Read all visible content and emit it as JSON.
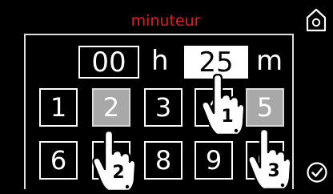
{
  "header": {
    "title": "minuteur"
  },
  "timer": {
    "hours": "00",
    "hours_unit": "h",
    "minutes": "25",
    "minutes_unit": "m"
  },
  "keypad": {
    "keys": [
      "1",
      "2",
      "3",
      "4",
      "5",
      "6",
      "7",
      "8",
      "9",
      "0"
    ],
    "pressed": [
      "2",
      "5"
    ]
  },
  "steps": {
    "step1": "1",
    "step2": "2",
    "step3": "3"
  },
  "icons": {
    "home": "home-icon",
    "confirm": "checkmark-circle-icon"
  },
  "colors": {
    "background": "#000000",
    "title": "#e01b24",
    "pressed_key": "#a8a8a8",
    "selected_field": "#ffffff"
  }
}
